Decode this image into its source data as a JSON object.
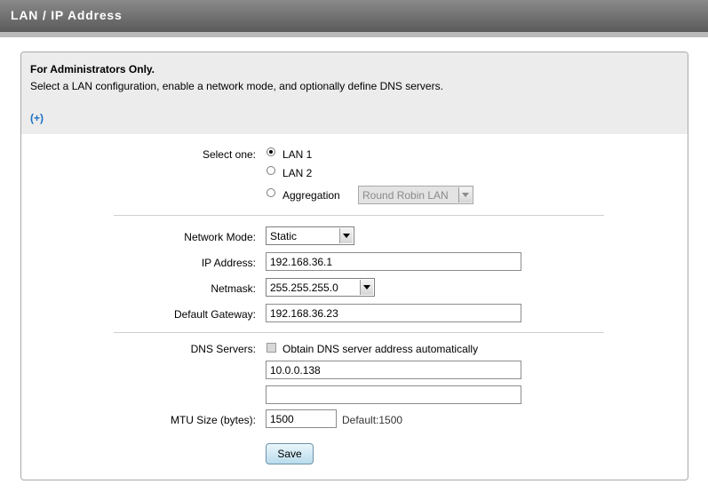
{
  "header": {
    "title": "LAN / IP Address"
  },
  "notice": {
    "title": "For Administrators Only.",
    "text": "Select a LAN configuration, enable a network mode, and optionally define DNS servers.",
    "expand_link": "(+)"
  },
  "lan": {
    "label": "Select one:",
    "options": [
      {
        "label": "LAN 1",
        "selected": true
      },
      {
        "label": "LAN 2",
        "selected": false
      },
      {
        "label": "Aggregation",
        "selected": false
      }
    ],
    "aggregation_mode": "Round Robin LAN"
  },
  "network": {
    "mode_label": "Network Mode:",
    "mode_value": "Static",
    "ip_label": "IP Address:",
    "ip_value": "192.168.36.1",
    "netmask_label": "Netmask:",
    "netmask_value": "255.255.255.0",
    "gateway_label": "Default Gateway:",
    "gateway_value": "192.168.36.23"
  },
  "dns": {
    "label": "DNS Servers:",
    "auto_label": "Obtain DNS server address automatically",
    "auto_checked": false,
    "server1": "10.0.0.138",
    "server2": ""
  },
  "mtu": {
    "label": "MTU Size (bytes):",
    "value": "1500",
    "default_text": "Default:1500"
  },
  "actions": {
    "save_label": "Save"
  }
}
